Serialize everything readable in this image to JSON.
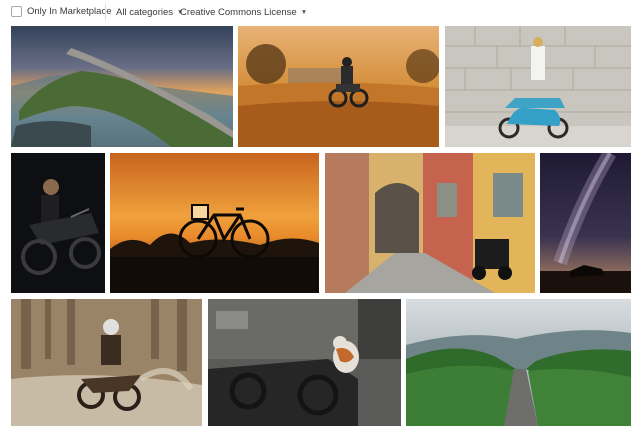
{
  "filters": {
    "marketplace_label": "Only In Marketplace",
    "category_label": "All categories",
    "license_label": "Creative Commons License",
    "marketplace_checked": false
  },
  "photos": [
    {
      "subject": "coastal road bridge at sunset",
      "icon": "photo"
    },
    {
      "subject": "motorcyclist on country road in golden light",
      "icon": "photo"
    },
    {
      "subject": "woman on blue scooter by stone wall",
      "icon": "photo"
    },
    {
      "subject": "woman with motorcycle on dark background",
      "icon": "photo"
    },
    {
      "subject": "bicycle silhouette at sunset",
      "icon": "photo"
    },
    {
      "subject": "narrow street with scooter",
      "icon": "photo"
    },
    {
      "subject": "milky way over motorcycle",
      "icon": "photo"
    },
    {
      "subject": "dirt bike rider splashing mud",
      "icon": "photo"
    },
    {
      "subject": "cat on old motorcycle",
      "icon": "photo"
    },
    {
      "subject": "road through green valley",
      "icon": "photo"
    }
  ]
}
